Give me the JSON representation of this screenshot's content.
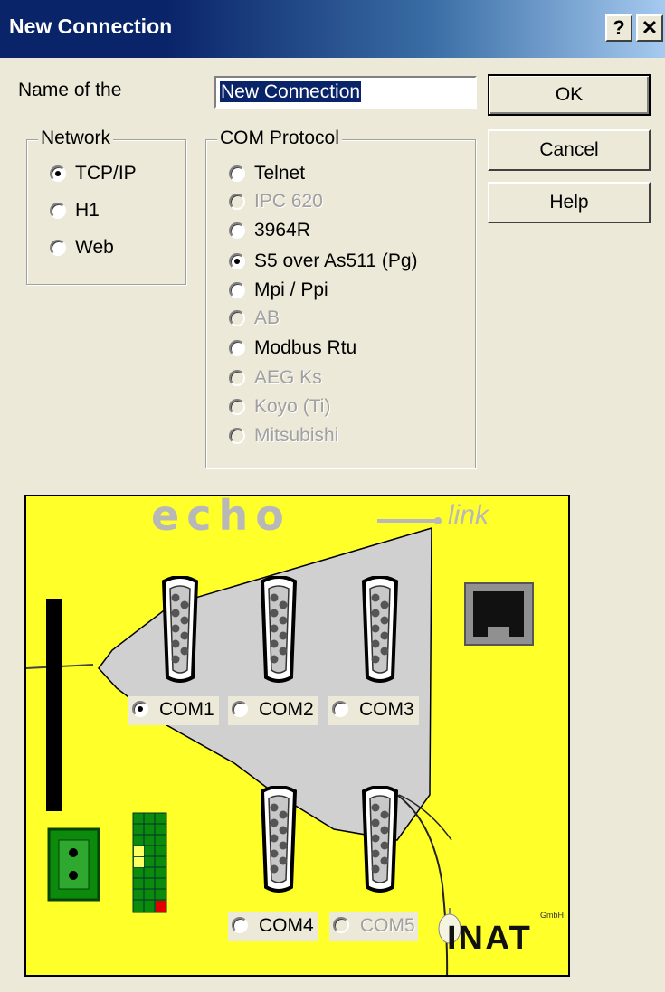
{
  "window": {
    "title": "New Connection",
    "help_glyph": "?",
    "close_glyph": "✕"
  },
  "name": {
    "label": "Name of the",
    "value": "New Connection"
  },
  "buttons": {
    "ok": "OK",
    "cancel": "Cancel",
    "help": "Help"
  },
  "network": {
    "legend": "Network",
    "options": [
      {
        "label": "TCP/IP",
        "checked": true,
        "enabled": true
      },
      {
        "label": "H1",
        "checked": false,
        "enabled": true
      },
      {
        "label": "Web",
        "checked": false,
        "enabled": true
      }
    ]
  },
  "protocol": {
    "legend": "COM Protocol",
    "options": [
      {
        "label": "Telnet",
        "checked": false,
        "enabled": true
      },
      {
        "label": "IPC 620",
        "checked": false,
        "enabled": false
      },
      {
        "label": "3964R",
        "checked": false,
        "enabled": true
      },
      {
        "label": "S5 over As511 (Pg)",
        "checked": true,
        "enabled": true
      },
      {
        "label": "Mpi / Ppi",
        "checked": false,
        "enabled": true
      },
      {
        "label": "AB",
        "checked": false,
        "enabled": false
      },
      {
        "label": "Modbus Rtu",
        "checked": false,
        "enabled": true
      },
      {
        "label": "AEG Ks",
        "checked": false,
        "enabled": false
      },
      {
        "label": "Koyo (Ti)",
        "checked": false,
        "enabled": false
      },
      {
        "label": "Mitsubishi",
        "checked": false,
        "enabled": false
      }
    ]
  },
  "device": {
    "logo_word": "echo",
    "logo_suffix": "link",
    "brand": "INAT",
    "brand_suffix": "GmbH",
    "ports": [
      {
        "label": "COM1",
        "checked": true,
        "enabled": true
      },
      {
        "label": "COM2",
        "checked": false,
        "enabled": true
      },
      {
        "label": "COM3",
        "checked": false,
        "enabled": true
      },
      {
        "label": "COM4",
        "checked": false,
        "enabled": true
      },
      {
        "label": "COM5",
        "checked": false,
        "enabled": false
      }
    ]
  },
  "colors": {
    "titlebar": "#0a246a",
    "panel": "#ffff2a",
    "dialog": "#ece9d8"
  }
}
